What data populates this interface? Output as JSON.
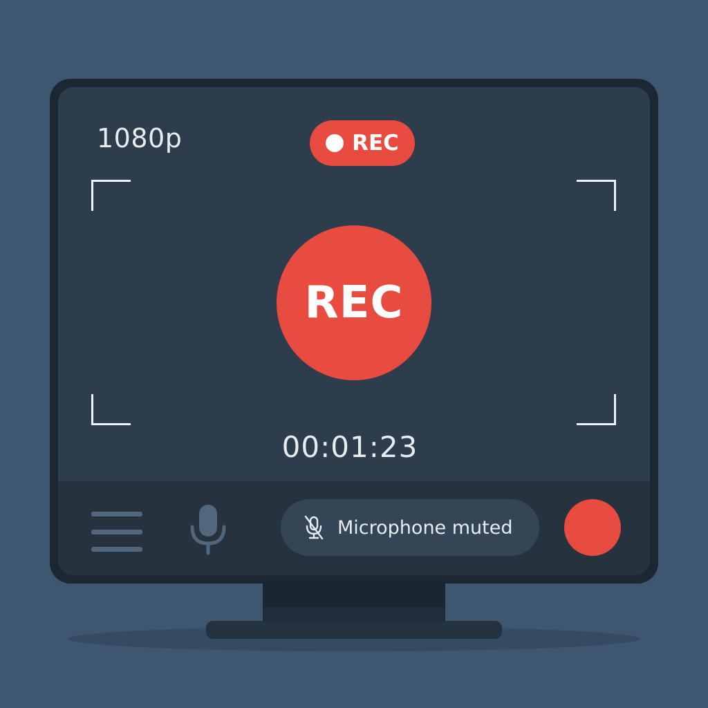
{
  "colors": {
    "background": "#3f5670",
    "screen": "#2e3d4b",
    "accent_red": "#e84b3f",
    "control_bar": "#26333f",
    "text": "#e7ecf0"
  },
  "header": {
    "resolution": "1080p",
    "rec_badge": "REC"
  },
  "main": {
    "record_button_label": "REC",
    "timer": "00:01:23"
  },
  "control_bar": {
    "menu_icon": "hamburger-menu-icon",
    "mic_icon": "microphone-icon",
    "mute_status_icon": "microphone-off-icon",
    "mute_status": "Microphone muted",
    "record_icon": "record-dot-icon"
  }
}
